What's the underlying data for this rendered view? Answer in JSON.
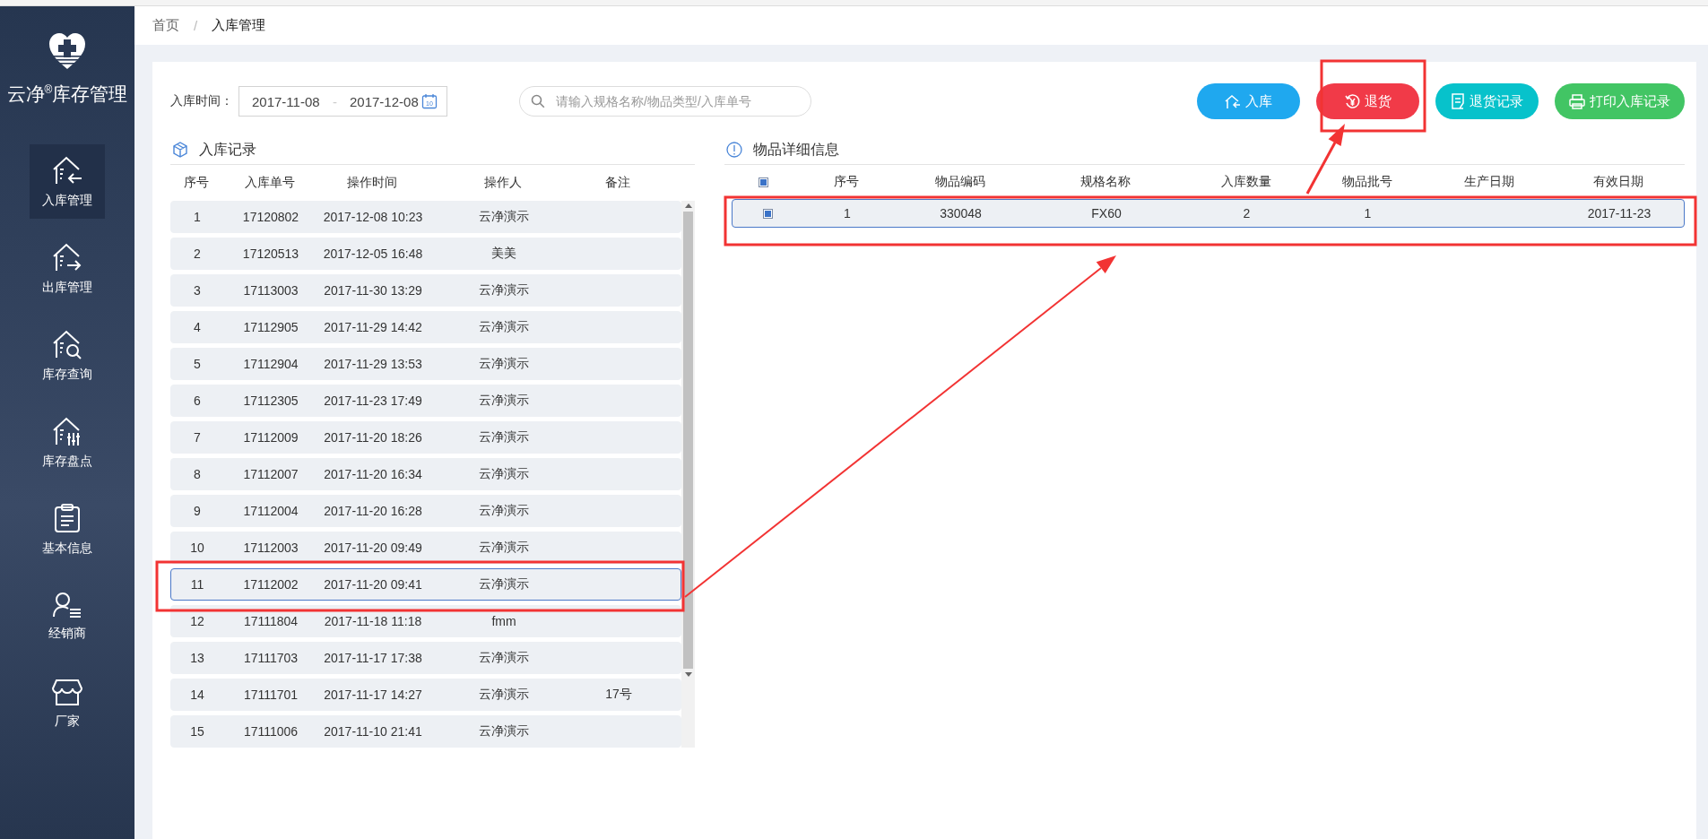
{
  "sidebar": {
    "logo_text": "云净$^{®}$库存管理",
    "items": [
      {
        "label": "入库管理",
        "kind": "inbound",
        "selected": true
      },
      {
        "label": "出库管理",
        "kind": "outbound",
        "selected": false
      },
      {
        "label": "库存查询",
        "kind": "query",
        "selected": false
      },
      {
        "label": "库存盘点",
        "kind": "stocktake",
        "selected": false
      },
      {
        "label": "基本信息",
        "kind": "info",
        "selected": false
      },
      {
        "label": "经销商",
        "kind": "dealer",
        "selected": false
      },
      {
        "label": "厂家",
        "kind": "factory",
        "selected": false
      }
    ]
  },
  "breadcrumb": {
    "items": [
      "首页",
      "入库管理"
    ],
    "separator": "/"
  },
  "filter": {
    "label": "入库时间：",
    "start": "2017-11-08",
    "separator": "-",
    "end": "2017-12-08",
    "calendar_day": "10"
  },
  "search": {
    "placeholder": "请输入规格名称/物品类型/入库单号"
  },
  "buttons": [
    {
      "label": "入库",
      "kind": "inbound",
      "color": "#1fa8ef"
    },
    {
      "label": "退货",
      "kind": "return",
      "color": "#f13a48"
    },
    {
      "label": "退货记录",
      "kind": "return_log",
      "color": "#07c2cb"
    },
    {
      "label": "打印入库记录",
      "kind": "print",
      "color": "#42c564"
    }
  ],
  "records": {
    "title": "入库记录",
    "columns": [
      "序号",
      "入库单号",
      "操作时间",
      "操作人",
      "备注"
    ],
    "rows": [
      {
        "cells": [
          "1",
          "17120802",
          "2017-12-08 10:23",
          "云净演示",
          ""
        ],
        "selected": false
      },
      {
        "cells": [
          "2",
          "17120513",
          "2017-12-05 16:48",
          "美美",
          ""
        ],
        "selected": false
      },
      {
        "cells": [
          "3",
          "17113003",
          "2017-11-30 13:29",
          "云净演示",
          ""
        ],
        "selected": false
      },
      {
        "cells": [
          "4",
          "17112905",
          "2017-11-29 14:42",
          "云净演示",
          ""
        ],
        "selected": false
      },
      {
        "cells": [
          "5",
          "17112904",
          "2017-11-29 13:53",
          "云净演示",
          ""
        ],
        "selected": false
      },
      {
        "cells": [
          "6",
          "17112305",
          "2017-11-23 17:49",
          "云净演示",
          ""
        ],
        "selected": false
      },
      {
        "cells": [
          "7",
          "17112009",
          "2017-11-20 18:26",
          "云净演示",
          ""
        ],
        "selected": false
      },
      {
        "cells": [
          "8",
          "17112007",
          "2017-11-20 16:34",
          "云净演示",
          ""
        ],
        "selected": false
      },
      {
        "cells": [
          "9",
          "17112004",
          "2017-11-20 16:28",
          "云净演示",
          ""
        ],
        "selected": false
      },
      {
        "cells": [
          "10",
          "17112003",
          "2017-11-20 09:49",
          "云净演示",
          ""
        ],
        "selected": false
      },
      {
        "cells": [
          "11",
          "17112002",
          "2017-11-20 09:41",
          "云净演示",
          ""
        ],
        "selected": true
      },
      {
        "cells": [
          "12",
          "17111804",
          "2017-11-18 11:18",
          "fmm",
          ""
        ],
        "selected": false
      },
      {
        "cells": [
          "13",
          "17111703",
          "2017-11-17 17:38",
          "云净演示",
          ""
        ],
        "selected": false
      },
      {
        "cells": [
          "14",
          "17111701",
          "2017-11-17 14:27",
          "云净演示",
          "17号"
        ],
        "selected": false
      },
      {
        "cells": [
          "15",
          "17111006",
          "2017-11-10 21:41",
          "云净演示",
          ""
        ],
        "selected": false
      }
    ]
  },
  "details": {
    "title": "物品详细信息",
    "select_all_checked": true,
    "columns": [
      "序号",
      "物品编码",
      "规格名称",
      "入库数量",
      "物品批号",
      "生产日期",
      "有效日期"
    ],
    "rows": [
      {
        "cells": [
          "1",
          "330048",
          "FX60",
          "2",
          "1",
          "",
          "2017-11-23"
        ],
        "checked": true,
        "selected": true
      }
    ]
  }
}
